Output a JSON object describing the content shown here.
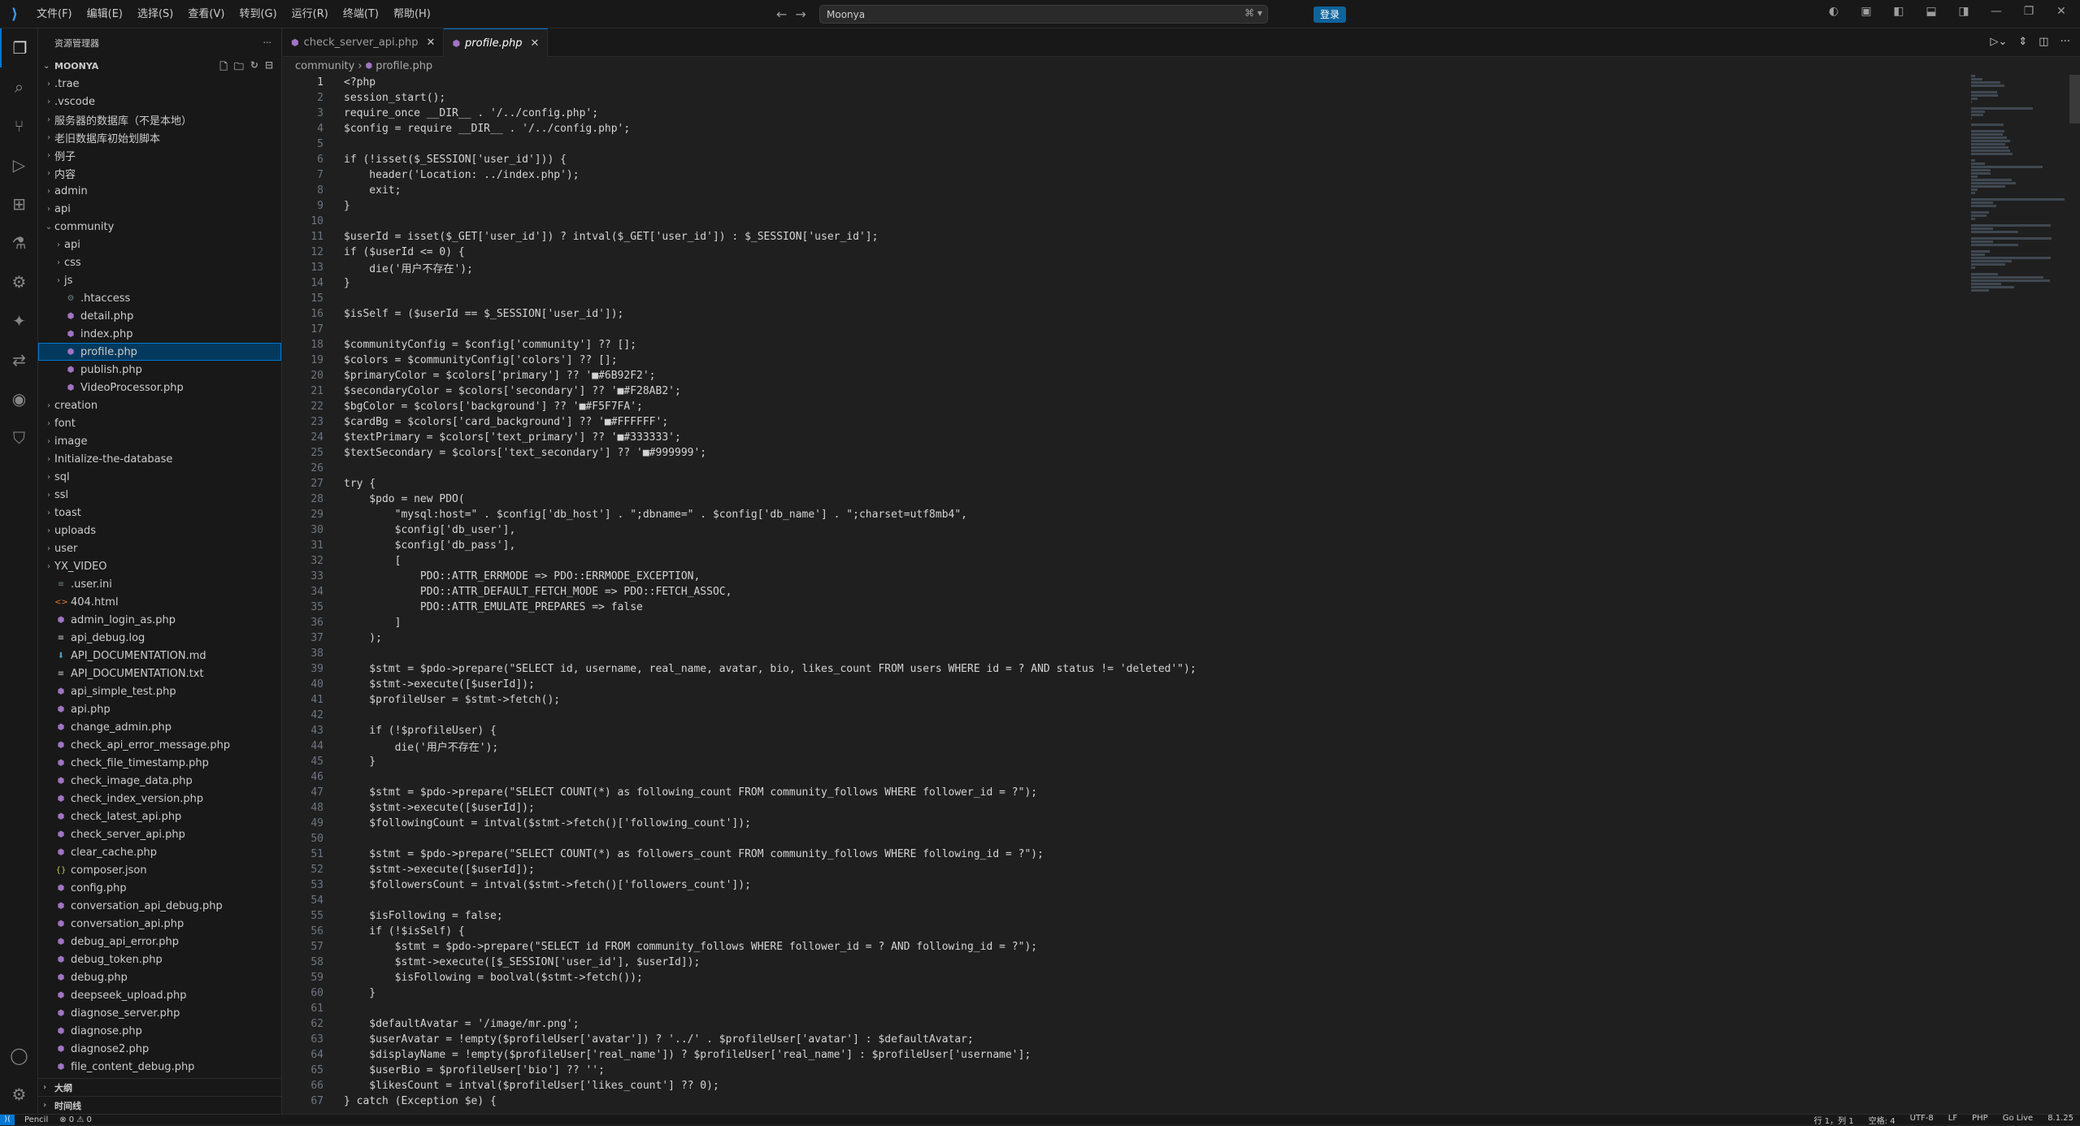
{
  "titlebar": {
    "menu": [
      "文件(F)",
      "编辑(E)",
      "选择(S)",
      "查看(V)",
      "转到(G)",
      "运行(R)",
      "终端(T)",
      "帮助(H)"
    ],
    "search_text": "Moonya",
    "login_label": "登录"
  },
  "sidebar": {
    "title": "资源管理器",
    "project": "MOONYA",
    "tree": [
      {
        "label": ".trae",
        "type": "folder",
        "depth": 0
      },
      {
        "label": ".vscode",
        "type": "folder",
        "depth": 0
      },
      {
        "label": "服务器的数据库（不是本地）",
        "type": "folder",
        "depth": 0
      },
      {
        "label": "老旧数据库初始划脚本",
        "type": "folder",
        "depth": 0
      },
      {
        "label": "例子",
        "type": "folder",
        "depth": 0
      },
      {
        "label": "内容",
        "type": "folder",
        "depth": 0
      },
      {
        "label": "admin",
        "type": "folder",
        "depth": 0
      },
      {
        "label": "api",
        "type": "folder",
        "depth": 0
      },
      {
        "label": "community",
        "type": "folder-open",
        "depth": 0
      },
      {
        "label": "api",
        "type": "folder",
        "depth": 1
      },
      {
        "label": "css",
        "type": "folder",
        "depth": 1
      },
      {
        "label": "js",
        "type": "folder",
        "depth": 1
      },
      {
        "label": ".htaccess",
        "type": "gear",
        "depth": 1
      },
      {
        "label": "detail.php",
        "type": "php",
        "depth": 1
      },
      {
        "label": "index.php",
        "type": "php",
        "depth": 1
      },
      {
        "label": "profile.php",
        "type": "php",
        "depth": 1,
        "selected": true
      },
      {
        "label": "publish.php",
        "type": "php",
        "depth": 1
      },
      {
        "label": "VideoProcessor.php",
        "type": "php",
        "depth": 1
      },
      {
        "label": "creation",
        "type": "folder",
        "depth": 0
      },
      {
        "label": "font",
        "type": "folder",
        "depth": 0
      },
      {
        "label": "image",
        "type": "folder",
        "depth": 0
      },
      {
        "label": "Initialize-the-database",
        "type": "folder",
        "depth": 0
      },
      {
        "label": "sql",
        "type": "folder",
        "depth": 0
      },
      {
        "label": "ssl",
        "type": "folder",
        "depth": 0
      },
      {
        "label": "toast",
        "type": "folder",
        "depth": 0
      },
      {
        "label": "uploads",
        "type": "folder",
        "depth": 0
      },
      {
        "label": "user",
        "type": "folder",
        "depth": 0
      },
      {
        "label": "YX_VIDEO",
        "type": "folder",
        "depth": 0
      },
      {
        "label": ".user.ini",
        "type": "ini",
        "depth": 0
      },
      {
        "label": "404.html",
        "type": "html",
        "depth": 0
      },
      {
        "label": "admin_login_as.php",
        "type": "php",
        "depth": 0
      },
      {
        "label": "api_debug.log",
        "type": "log",
        "depth": 0
      },
      {
        "label": "API_DOCUMENTATION.md",
        "type": "md",
        "depth": 0
      },
      {
        "label": "API_DOCUMENTATION.txt",
        "type": "txt",
        "depth": 0
      },
      {
        "label": "api_simple_test.php",
        "type": "php",
        "depth": 0
      },
      {
        "label": "api.php",
        "type": "php",
        "depth": 0
      },
      {
        "label": "change_admin.php",
        "type": "php",
        "depth": 0
      },
      {
        "label": "check_api_error_message.php",
        "type": "php",
        "depth": 0
      },
      {
        "label": "check_file_timestamp.php",
        "type": "php",
        "depth": 0
      },
      {
        "label": "check_image_data.php",
        "type": "php",
        "depth": 0
      },
      {
        "label": "check_index_version.php",
        "type": "php",
        "depth": 0
      },
      {
        "label": "check_latest_api.php",
        "type": "php",
        "depth": 0
      },
      {
        "label": "check_server_api.php",
        "type": "php",
        "depth": 0
      },
      {
        "label": "clear_cache.php",
        "type": "php",
        "depth": 0
      },
      {
        "label": "composer.json",
        "type": "json",
        "depth": 0
      },
      {
        "label": "config.php",
        "type": "php",
        "depth": 0
      },
      {
        "label": "conversation_api_debug.php",
        "type": "php",
        "depth": 0
      },
      {
        "label": "conversation_api.php",
        "type": "php",
        "depth": 0
      },
      {
        "label": "debug_api_error.php",
        "type": "php",
        "depth": 0
      },
      {
        "label": "debug_token.php",
        "type": "php",
        "depth": 0
      },
      {
        "label": "debug.php",
        "type": "php",
        "depth": 0
      },
      {
        "label": "deepseek_upload.php",
        "type": "php",
        "depth": 0
      },
      {
        "label": "diagnose_server.php",
        "type": "php",
        "depth": 0
      },
      {
        "label": "diagnose.php",
        "type": "php",
        "depth": 0
      },
      {
        "label": "diagnose2.php",
        "type": "php",
        "depth": 0
      },
      {
        "label": "file_content_debug.php",
        "type": "php",
        "depth": 0
      }
    ],
    "panels": [
      "大纲",
      "时间线"
    ]
  },
  "tabs": [
    {
      "label": "check_server_api.php",
      "active": false
    },
    {
      "label": "profile.php",
      "active": true
    }
  ],
  "breadcrumb": [
    "community",
    "profile.php"
  ],
  "code": [
    "<?php",
    "session_start();",
    "require_once __DIR__ . '/../config.php';",
    "$config = require __DIR__ . '/../config.php';",
    "",
    "if (!isset($_SESSION['user_id'])) {",
    "    header('Location: ../index.php');",
    "    exit;",
    "}",
    "",
    "$userId = isset($_GET['user_id']) ? intval($_GET['user_id']) : $_SESSION['user_id'];",
    "if ($userId <= 0) {",
    "    die('用户不存在');",
    "}",
    "",
    "$isSelf = ($userId == $_SESSION['user_id']);",
    "",
    "$communityConfig = $config['community'] ?? [];",
    "$colors = $communityConfig['colors'] ?? [];",
    "$primaryColor = $colors['primary'] ?? '■#6B92F2';",
    "$secondaryColor = $colors['secondary'] ?? '■#F28AB2';",
    "$bgColor = $colors['background'] ?? '■#F5F7FA';",
    "$cardBg = $colors['card_background'] ?? '■#FFFFFF';",
    "$textPrimary = $colors['text_primary'] ?? '■#333333';",
    "$textSecondary = $colors['text_secondary'] ?? '■#999999';",
    "",
    "try {",
    "    $pdo = new PDO(",
    "        \"mysql:host=\" . $config['db_host'] . \";dbname=\" . $config['db_name'] . \";charset=utf8mb4\",",
    "        $config['db_user'],",
    "        $config['db_pass'],",
    "        [",
    "            PDO::ATTR_ERRMODE => PDO::ERRMODE_EXCEPTION,",
    "            PDO::ATTR_DEFAULT_FETCH_MODE => PDO::FETCH_ASSOC,",
    "            PDO::ATTR_EMULATE_PREPARES => false",
    "        ]",
    "    );",
    "",
    "    $stmt = $pdo->prepare(\"SELECT id, username, real_name, avatar, bio, likes_count FROM users WHERE id = ? AND status != 'deleted'\");",
    "    $stmt->execute([$userId]);",
    "    $profileUser = $stmt->fetch();",
    "",
    "    if (!$profileUser) {",
    "        die('用户不存在');",
    "    }",
    "",
    "    $stmt = $pdo->prepare(\"SELECT COUNT(*) as following_count FROM community_follows WHERE follower_id = ?\");",
    "    $stmt->execute([$userId]);",
    "    $followingCount = intval($stmt->fetch()['following_count']);",
    "",
    "    $stmt = $pdo->prepare(\"SELECT COUNT(*) as followers_count FROM community_follows WHERE following_id = ?\");",
    "    $stmt->execute([$userId]);",
    "    $followersCount = intval($stmt->fetch()['followers_count']);",
    "",
    "    $isFollowing = false;",
    "    if (!$isSelf) {",
    "        $stmt = $pdo->prepare(\"SELECT id FROM community_follows WHERE follower_id = ? AND following_id = ?\");",
    "        $stmt->execute([$_SESSION['user_id'], $userId]);",
    "        $isFollowing = boolval($stmt->fetch());",
    "    }",
    "",
    "    $defaultAvatar = '/image/mr.png';",
    "    $userAvatar = !empty($profileUser['avatar']) ? '../' . $profileUser['avatar'] : $defaultAvatar;",
    "    $displayName = !empty($profileUser['real_name']) ? $profileUser['real_name'] : $profileUser['username'];",
    "    $userBio = $profileUser['bio'] ?? '';",
    "    $likesCount = intval($profileUser['likes_count'] ?? 0);",
    "} catch (Exception $e) {"
  ],
  "statusbar": {
    "left": [
      "Pencil",
      "⊗ 0 ⚠ 0"
    ],
    "right": [
      "行 1，列 1",
      "空格: 4",
      "UTF-8",
      "LF",
      "PHP",
      "Go Live",
      "8.1.25"
    ]
  },
  "colors": {
    "accent": "#0078d4",
    "background": "#1f1f1f",
    "sidebar": "#181818"
  }
}
